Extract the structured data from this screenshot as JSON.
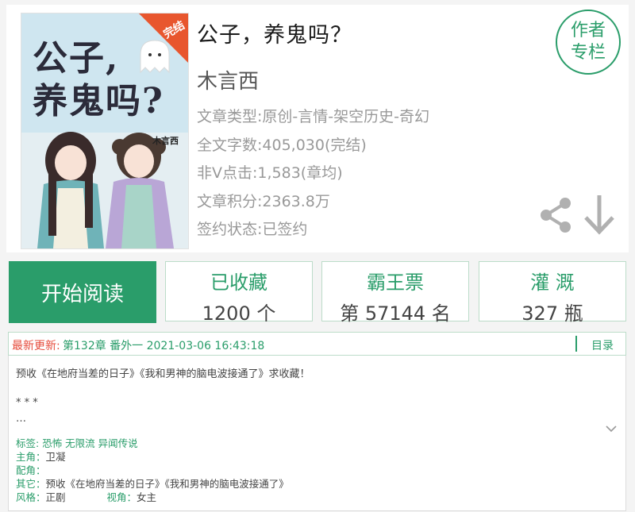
{
  "book": {
    "title": "公子，养鬼吗？",
    "author": "木言西",
    "info": [
      "文章类型:原创-言情-架空历史-奇幻",
      "全文字数:405,030(完结)",
      "非Ⅴ点击:1,583(章均)",
      "文章积分:2363.8万",
      "签约状态:已签约"
    ],
    "author_column_label": "作者\n专栏"
  },
  "cover": {
    "title_line1": "公子,",
    "title_line2": "养鬼吗?",
    "badge": "完结",
    "signature": "木言西"
  },
  "icons": {
    "share": "share-icon",
    "download": "download-icon",
    "expand": "chevron-down-icon"
  },
  "actions": {
    "read": "开始阅读",
    "collect": {
      "label": "已收藏",
      "value": "1200 个"
    },
    "overlord": {
      "label": "霸王票",
      "value": "第 57144 名"
    },
    "irrigate": {
      "label": "灌 溉",
      "value": "327 瓶"
    }
  },
  "update": {
    "label": "最新更新:",
    "text": "第132章 番外一 2021-03-06 16:43:18",
    "toc": "目录"
  },
  "description": {
    "line1": "预收《在地府当差的日子》《我和男神的脑电波接通了》求收藏！",
    "line2": "* * *",
    "line3": "…"
  },
  "meta": {
    "tags_label": "标签:",
    "tags_value": "恐怖 无限流 异闻传说",
    "protagonist_label": "主角：",
    "protagonist_value": "卫凝",
    "supporting_label": "配角：",
    "supporting_value": "",
    "other_label": "其它：",
    "other_value": "预收《在地府当差的日子》《我和男神的脑电波接通了》",
    "style_label": "风格：",
    "style_value": "正剧",
    "pov_label": "视角：",
    "pov_value": "女主"
  },
  "colors": {
    "accent": "#2a9d6a",
    "update_label": "#e64c3c",
    "muted_text": "#999999"
  }
}
